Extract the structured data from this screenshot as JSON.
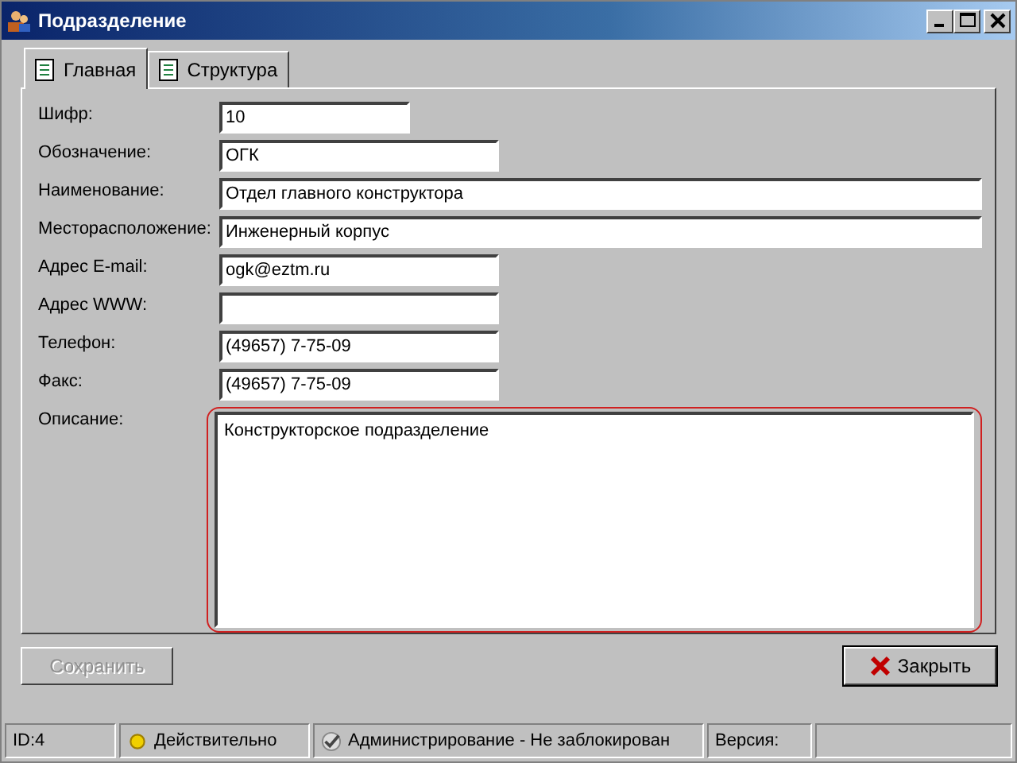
{
  "window": {
    "title": "Подразделение"
  },
  "tabs": [
    {
      "label": "Главная",
      "selected": true
    },
    {
      "label": "Структура",
      "selected": false
    }
  ],
  "fields": [
    {
      "label": "Шифр:",
      "value": "10",
      "kind": "short"
    },
    {
      "label": "Обозначение:",
      "value": "ОГК",
      "kind": "medium"
    },
    {
      "label": "Наименование:",
      "value": "Отдел главного конструктора",
      "kind": "full"
    },
    {
      "label": "Месторасположение:",
      "value": "Инженерный корпус",
      "kind": "full"
    },
    {
      "label": "Адрес E-mail:",
      "value": "ogk@eztm.ru",
      "kind": "medium"
    },
    {
      "label": "Адрес WWW:",
      "kind": "medium"
    },
    {
      "label": "Телефон:",
      "value": "(49657) 7-75-09",
      "kind": "medium"
    },
    {
      "label": "Факс:",
      "value": "(49657) 7-75-09",
      "kind": "medium"
    },
    {
      "label": "Описание:",
      "value": "Конструкторское подразделение",
      "kind": "multiline"
    }
  ],
  "buttons": [
    {
      "label": "Сохранить",
      "disabled": true
    },
    {
      "label": "Закрыть",
      "disabled": false
    }
  ],
  "status_bar": [
    "ID:4",
    "Действительно",
    "Администрирование - Не заблокирован",
    "Версия:"
  ]
}
